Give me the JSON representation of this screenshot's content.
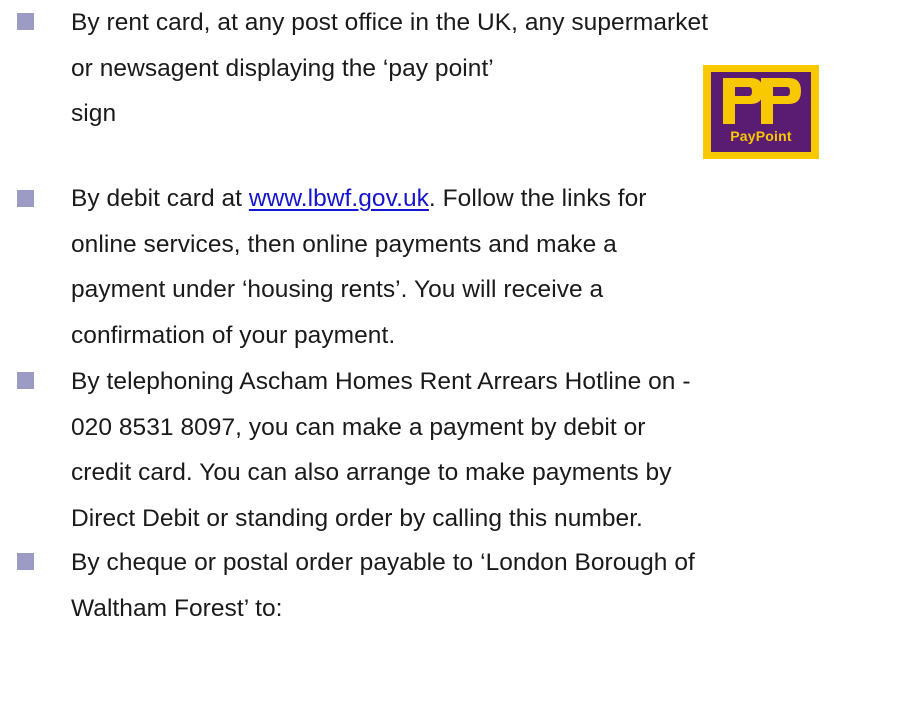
{
  "bullets": [
    {
      "lines": [
        "By rent card, at any post office in the UK, any supermarket",
        "or newsagent displaying the ‘pay point’",
        "sign"
      ]
    },
    {
      "line1_prefix": "By debit card at ",
      "link_text": "www.lbwf.gov.uk",
      "line1_suffix": ". Follow the links for",
      "lines": [
        "online services, then online payments and make a",
        "payment under ‘housing rents’. You will receive a",
        "confirmation of your payment."
      ]
    },
    {
      "lines": [
        "By telephoning Ascham Homes Rent Arrears Hotline on -",
        "020 8531 8097, you can make a payment by debit or",
        "credit card. You can also arrange to make payments by",
        "Direct Debit or standing order by calling this number."
      ]
    },
    {
      "lines": [
        "By cheque or postal order payable to ‘London Borough of",
        "Waltham Forest’ to:"
      ]
    }
  ],
  "logo": {
    "text": "PayPoint",
    "colors": {
      "background": "#f8c800",
      "panel": "#5a1c73"
    }
  },
  "colors": {
    "bullet": "#9b9bc4",
    "link": "#1515d0",
    "text": "#1a1a1a"
  }
}
